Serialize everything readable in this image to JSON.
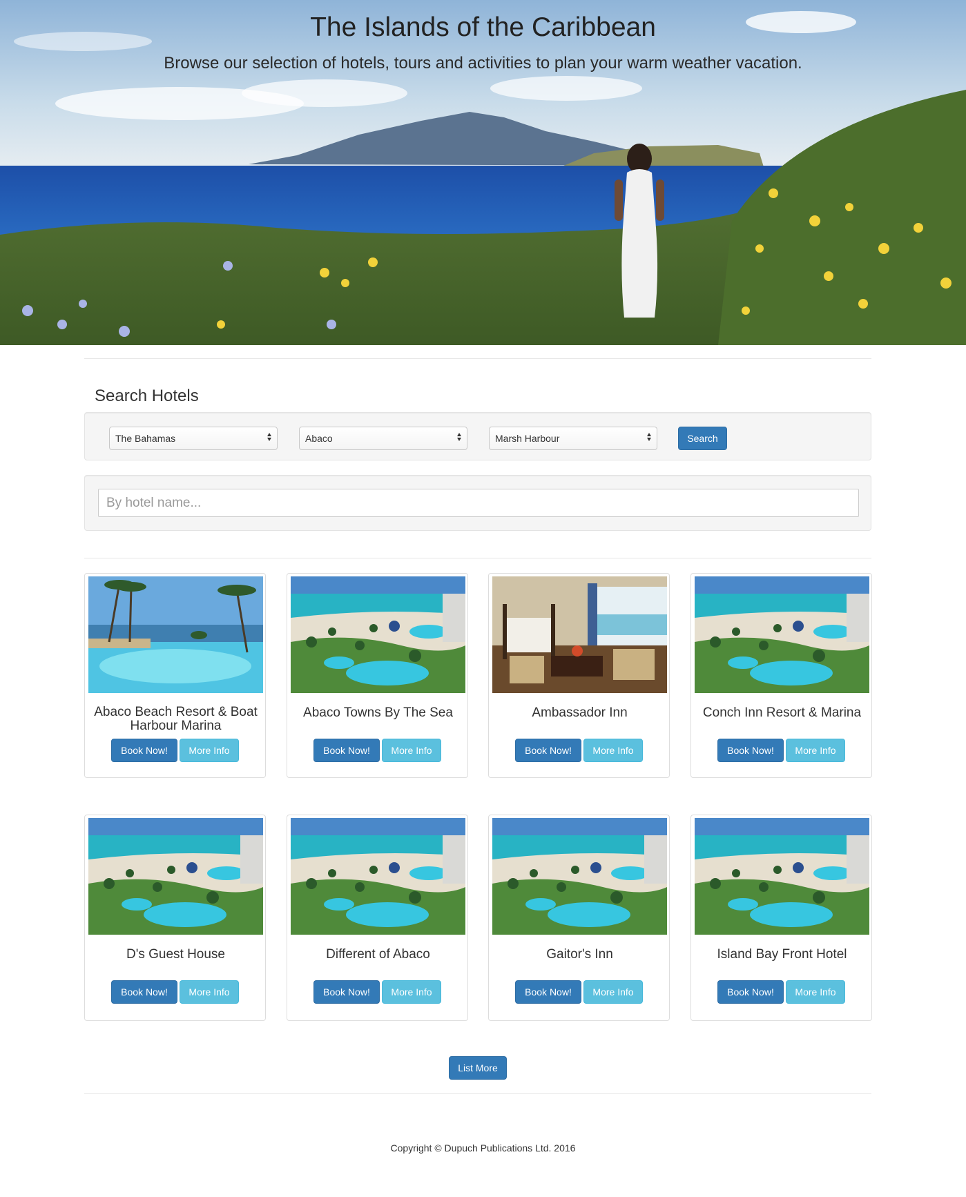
{
  "hero": {
    "title": "The Islands of the Caribbean",
    "subtitle": "Browse our selection of hotels, tours and activities to plan your warm weather vacation."
  },
  "search": {
    "heading": "Search Hotels",
    "country_select": "The Bahamas",
    "island_select": "Abaco",
    "town_select": "Marsh Harbour",
    "search_button": "Search",
    "name_placeholder": "By hotel name..."
  },
  "hotels": [
    {
      "name": "Abaco Beach Resort & Boat Harbour Marina",
      "image": "pool-palms"
    },
    {
      "name": "Abaco Towns By The Sea",
      "image": "resort-aerial"
    },
    {
      "name": "Ambassador Inn",
      "image": "hotel-room"
    },
    {
      "name": "Conch Inn Resort & Marina",
      "image": "resort-aerial"
    },
    {
      "name": "D's Guest House",
      "image": "resort-aerial"
    },
    {
      "name": "Different of Abaco",
      "image": "resort-aerial"
    },
    {
      "name": "Gaitor's Inn",
      "image": "resort-aerial"
    },
    {
      "name": "Island Bay Front Hotel",
      "image": "resort-aerial"
    }
  ],
  "card_buttons": {
    "book": "Book Now!",
    "more": "More Info"
  },
  "list_more_button": "List More",
  "footer": {
    "copyright": "Copyright © Dupuch Publications Ltd. 2016"
  },
  "colors": {
    "primary": "#337ab7",
    "info": "#5bc0de",
    "well": "#f5f5f5"
  }
}
